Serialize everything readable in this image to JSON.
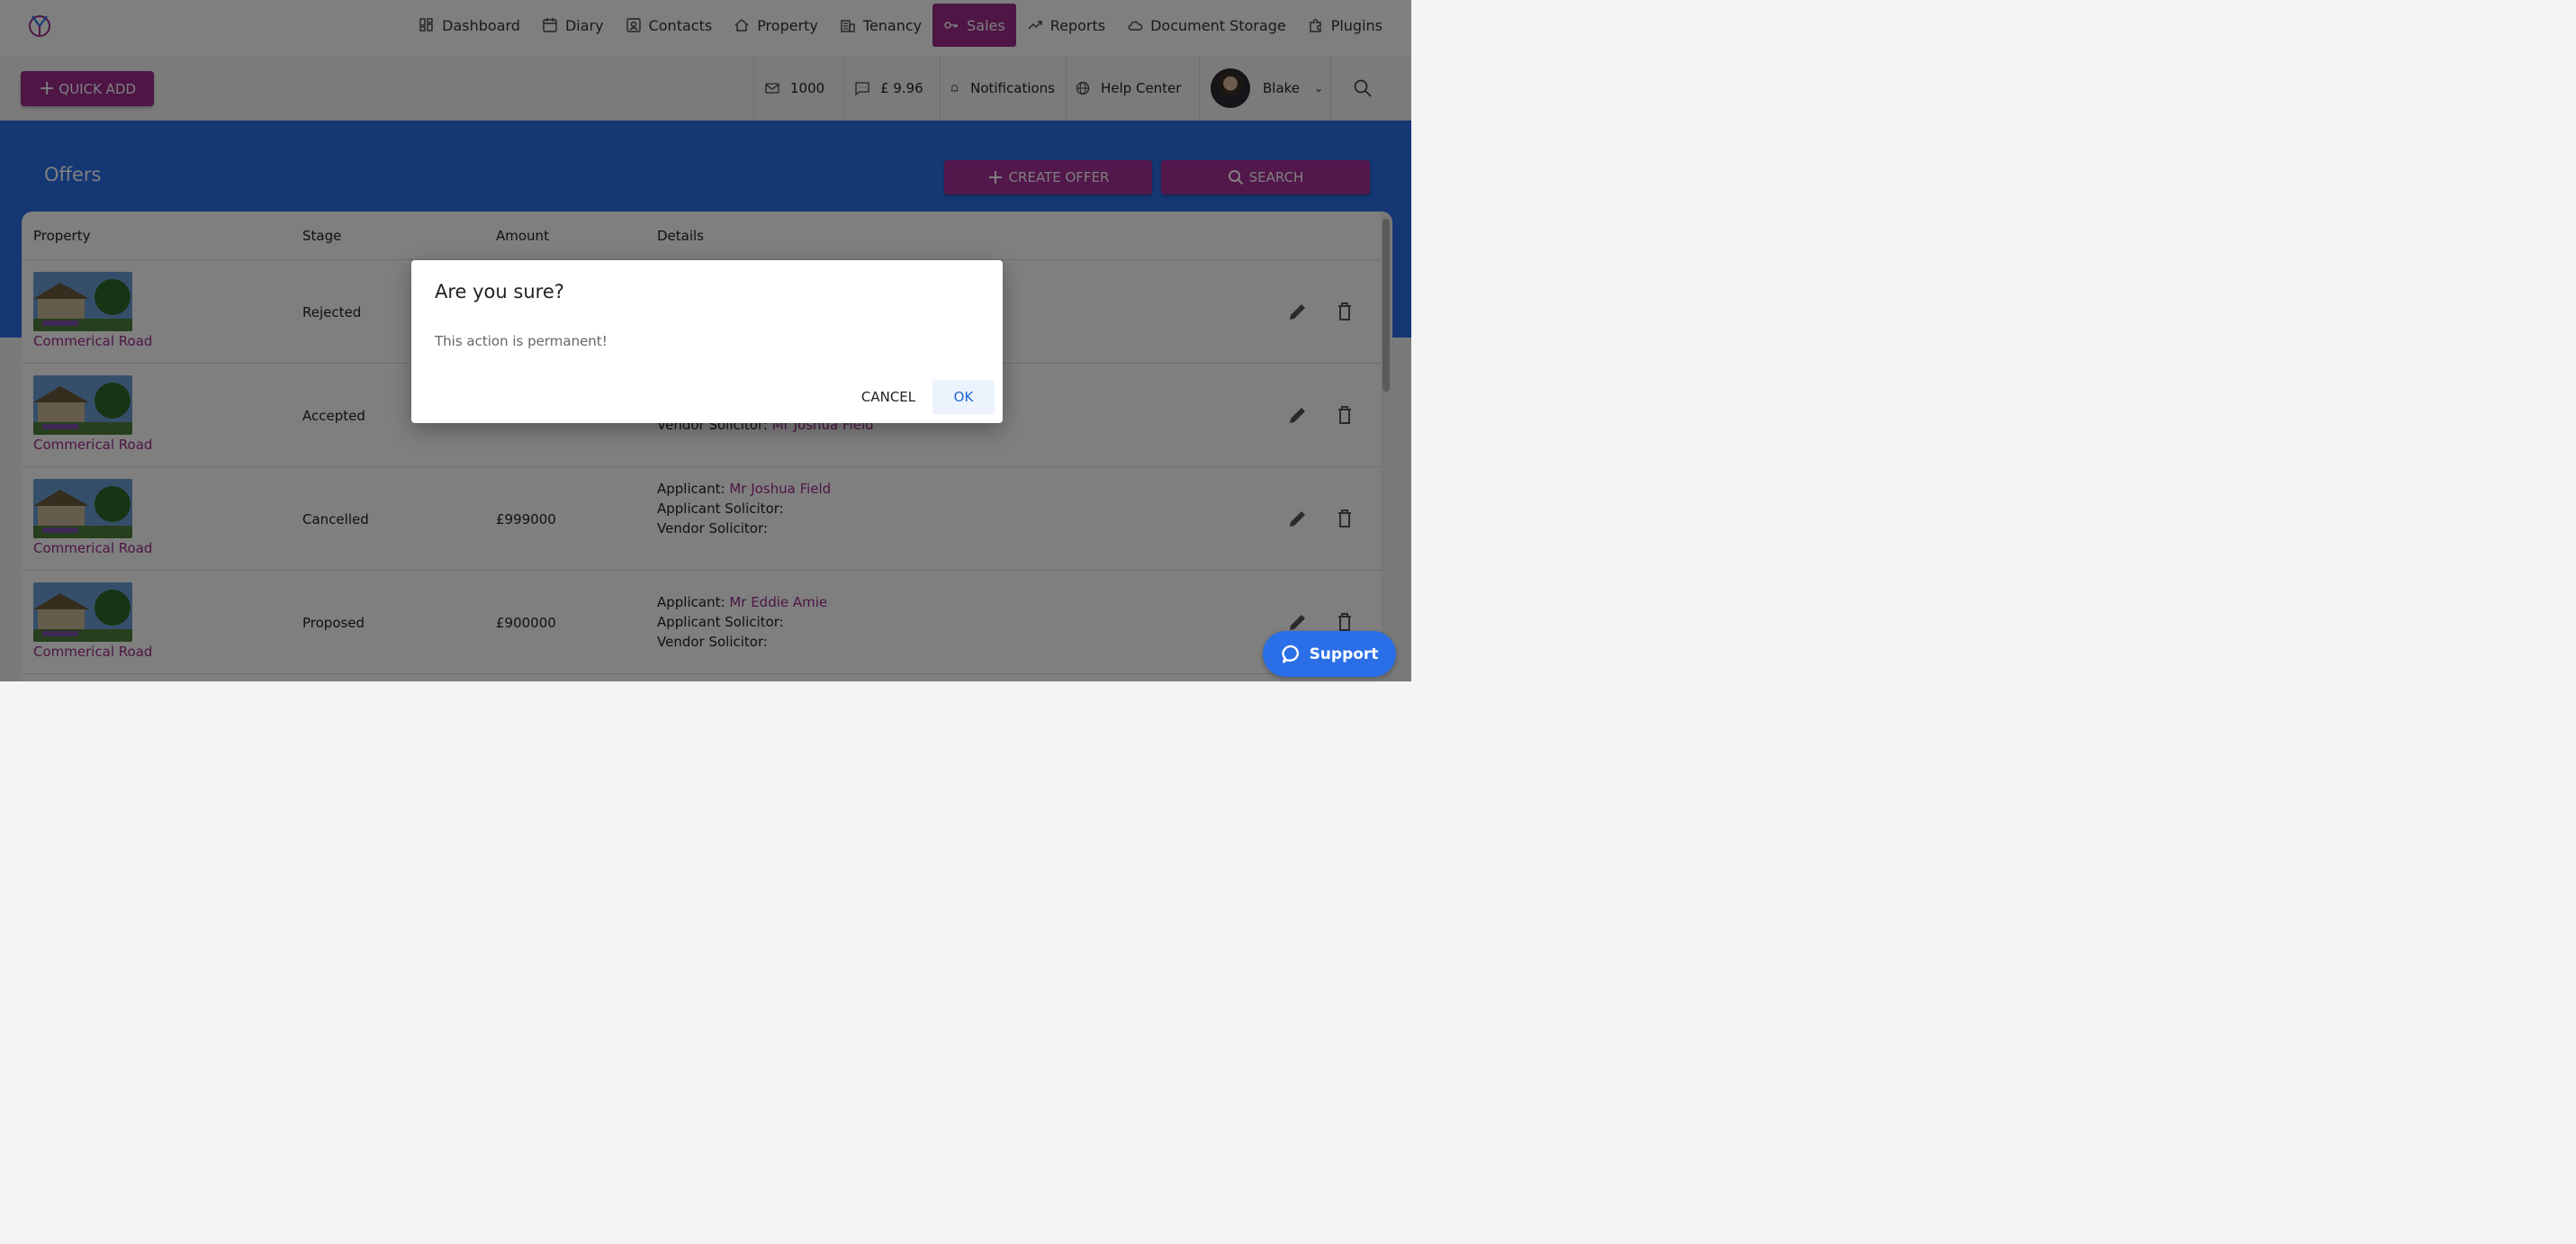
{
  "nav": {
    "items": [
      {
        "label": "Dashboard",
        "icon": "dashboard-icon",
        "active": false
      },
      {
        "label": "Diary",
        "icon": "calendar-icon",
        "active": false
      },
      {
        "label": "Contacts",
        "icon": "contacts-icon",
        "active": false
      },
      {
        "label": "Property",
        "icon": "home-icon",
        "active": false
      },
      {
        "label": "Tenancy",
        "icon": "building-icon",
        "active": false
      },
      {
        "label": "Sales",
        "icon": "key-icon",
        "active": true
      },
      {
        "label": "Reports",
        "icon": "trending-icon",
        "active": false
      },
      {
        "label": "Document Storage",
        "icon": "cloud-icon",
        "active": false
      },
      {
        "label": "Plugins",
        "icon": "puzzle-icon",
        "active": false
      }
    ]
  },
  "subbar": {
    "quick_add": "QUICK ADD",
    "email_count": "1000",
    "sms_credit": "£ 9.96",
    "notifications": "Notifications",
    "help_center": "Help Center",
    "user_name": "Blake"
  },
  "page": {
    "title": "Offers",
    "create_offer": "CREATE OFFER",
    "search": "SEARCH"
  },
  "table": {
    "headers": {
      "property": "Property",
      "stage": "Stage",
      "amount": "Amount",
      "details": "Details"
    },
    "rows": [
      {
        "property": "Commerical Road",
        "stage": "Rejected",
        "amount": "",
        "applicant": "",
        "vendor_solicitor": ""
      },
      {
        "property": "Commerical Road",
        "stage": "Accepted",
        "amount": "",
        "applicant": "",
        "vendor_solicitor": "Mr Joshua Field"
      },
      {
        "property": "Commerical Road",
        "stage": "Cancelled",
        "amount": "£999000",
        "applicant": "Mr Joshua Field",
        "vendor_solicitor": ""
      },
      {
        "property": "Commerical Road",
        "stage": "Proposed",
        "amount": "£900000",
        "applicant": "Mr Eddie Amie",
        "vendor_solicitor": ""
      }
    ],
    "labels": {
      "applicant": "Applicant:",
      "applicant_solicitor": "Applicant Solicitor:",
      "vendor_solicitor": "Vendor Solicitor:"
    }
  },
  "dialog": {
    "title": "Are you sure?",
    "message": "This action is permanent!",
    "cancel": "CANCEL",
    "ok": "OK"
  },
  "support": {
    "label": "Support"
  },
  "colors": {
    "brand": "#9c2a8b",
    "blue": "#2a6fe8"
  }
}
